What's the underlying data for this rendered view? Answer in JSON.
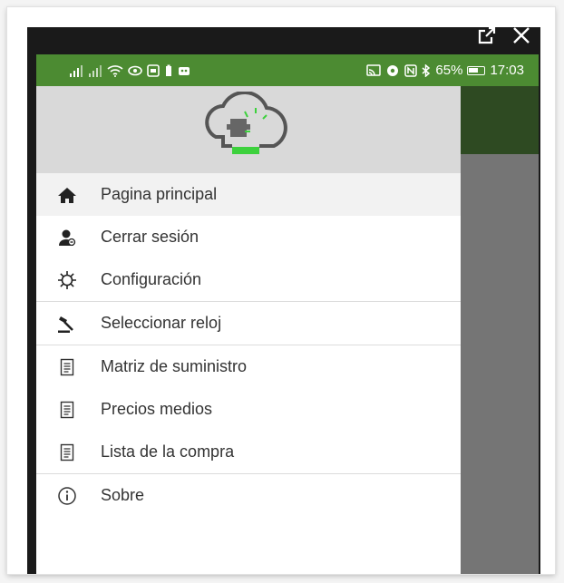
{
  "status_bar": {
    "battery": "65%",
    "time": "17:03"
  },
  "menu": {
    "items": [
      {
        "label": "Pagina principal",
        "icon": "home-icon"
      },
      {
        "label": "Cerrar sesión",
        "icon": "user-logout-icon"
      },
      {
        "label": "Configuración",
        "icon": "gear-icon"
      },
      {
        "label": "Seleccionar reloj",
        "icon": "gavel-icon"
      },
      {
        "label": "Matriz de suministro",
        "icon": "document-icon"
      },
      {
        "label": "Precios medios",
        "icon": "document-icon"
      },
      {
        "label": "Lista de la compra",
        "icon": "document-icon"
      },
      {
        "label": "Sobre",
        "icon": "info-icon"
      }
    ]
  },
  "colors": {
    "status_bar": "#4c8b32",
    "app_bar": "#2e4a22",
    "scrim": "#757575",
    "logo_accent": "#3dd13d"
  }
}
